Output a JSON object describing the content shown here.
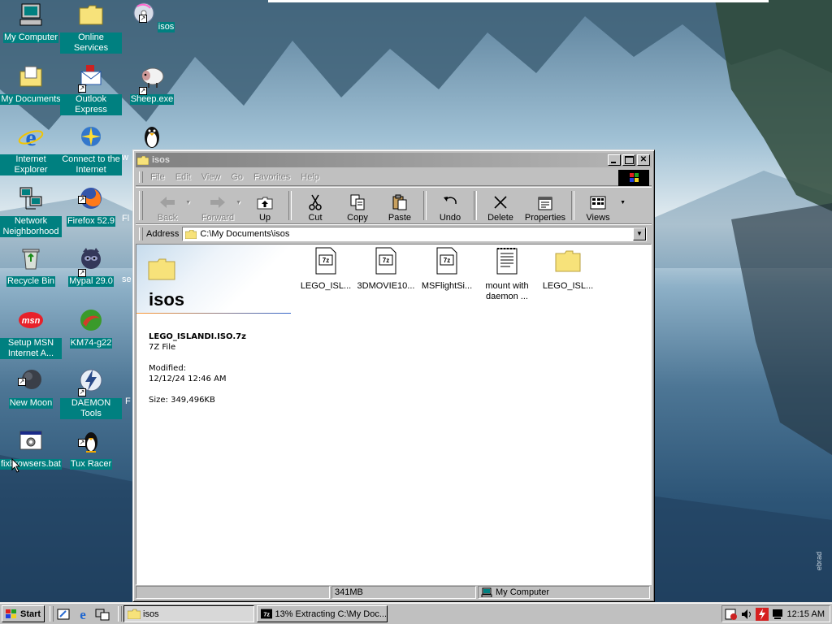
{
  "desktop": {
    "icons": [
      {
        "label": "My Computer"
      },
      {
        "label": "Online Services"
      },
      {
        "label": "isos"
      },
      {
        "label": "My Documents"
      },
      {
        "label": "Outlook Express"
      },
      {
        "label": "Sheep.exe"
      },
      {
        "label": "Internet Explorer"
      },
      {
        "label": "Connect to the Internet"
      },
      {
        "label": "Network Neighborhood"
      },
      {
        "label": "Firefox 52.9"
      },
      {
        "label": "Recycle Bin"
      },
      {
        "label": "Mypal 29.0"
      },
      {
        "label": "Setup MSN Internet A..."
      },
      {
        "label": "KM74-g22"
      },
      {
        "label": "New Moon"
      },
      {
        "label": "DAEMON Tools"
      },
      {
        "label": "fixbrowsers.bat"
      },
      {
        "label": "Tux Racer"
      }
    ],
    "partial_labels": [
      "w",
      "Fl",
      "se",
      "F"
    ]
  },
  "window": {
    "title": "isos",
    "menu": [
      "File",
      "Edit",
      "View",
      "Go",
      "Favorites",
      "Help"
    ],
    "toolbar": {
      "back": "Back",
      "forward": "Forward",
      "up": "Up",
      "cut": "Cut",
      "copy": "Copy",
      "paste": "Paste",
      "undo": "Undo",
      "delete": "Delete",
      "properties": "Properties",
      "views": "Views"
    },
    "address": {
      "label": "Address",
      "value": "C:\\My Documents\\isos"
    },
    "webview": {
      "title": "isos",
      "file_name": "LEGO_ISLANDI.ISO.7z",
      "file_type": "7Z File",
      "modified_label": "Modified:",
      "modified_value": "12/12/24 12:46 AM",
      "size": "Size: 349,496KB"
    },
    "files": [
      {
        "name": "LEGO_ISL...",
        "kind": "7z"
      },
      {
        "name": "3DMOVIE10...",
        "kind": "7z"
      },
      {
        "name": "MSFlightSi...",
        "kind": "7z"
      },
      {
        "name": "mount with daemon ...",
        "kind": "text"
      },
      {
        "name": "LEGO_ISL...",
        "kind": "folder"
      }
    ],
    "status": {
      "size": "341MB",
      "zone": "My Computer"
    }
  },
  "taskbar": {
    "start": "Start",
    "tasks": [
      {
        "label": "isos"
      },
      {
        "label": "13% Extracting C:\\My Doc..."
      }
    ],
    "clock": "12:15 AM"
  },
  "watermark": "ebrad",
  "colors": {
    "desktop_label_bg": "#008080",
    "window_face": "#c0c0c0",
    "inactive_title": "#808080"
  }
}
